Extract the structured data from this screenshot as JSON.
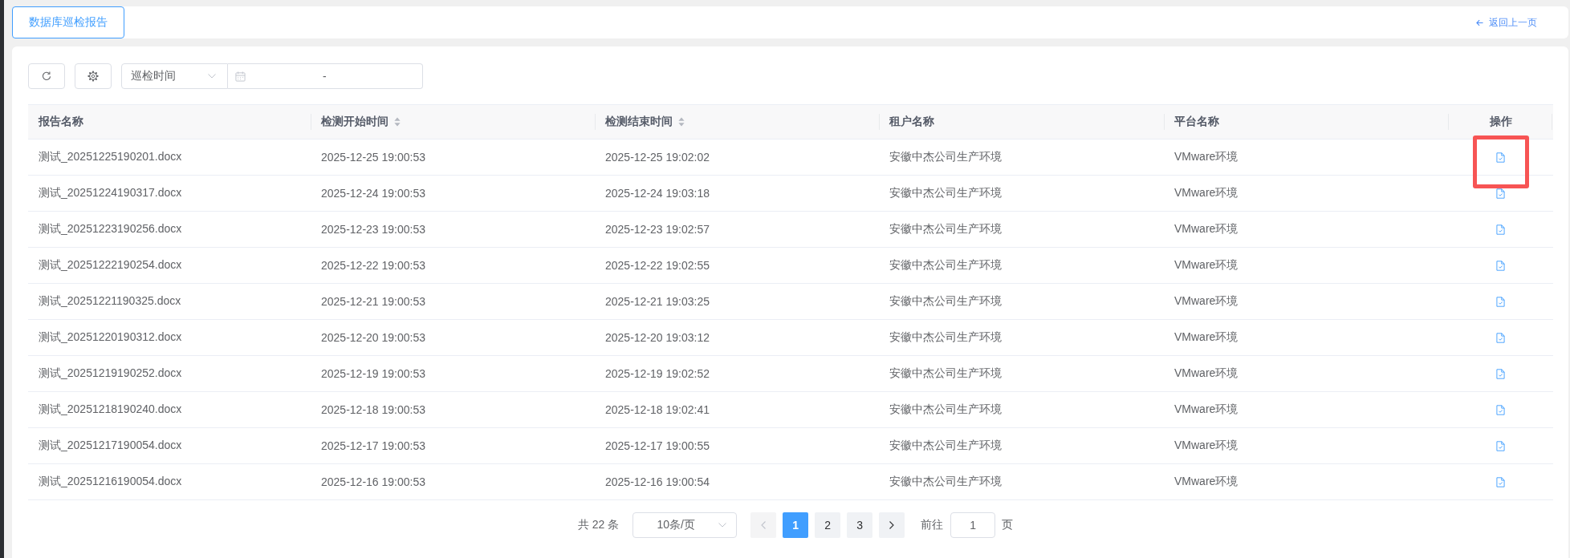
{
  "tabs": [
    {
      "label": "数据库巡检报告",
      "selected": true
    }
  ],
  "back_link": {
    "label": "返回上一页"
  },
  "toolbar": {
    "filter_select": {
      "value": "巡检时间"
    },
    "date_range": {
      "separator": "-"
    }
  },
  "table": {
    "columns": [
      {
        "label": "报告名称",
        "kind": "text",
        "sortable": false
      },
      {
        "label": "检测开始时间",
        "kind": "text",
        "sortable": true
      },
      {
        "label": "检测结束时间",
        "kind": "text",
        "sortable": true
      },
      {
        "label": "租户名称",
        "kind": "text",
        "sortable": false
      },
      {
        "label": "平台名称",
        "kind": "text",
        "sortable": false
      },
      {
        "label": "操作",
        "kind": "action",
        "sortable": false
      }
    ],
    "rows": [
      {
        "cells": [
          "测试_20251225190201.docx",
          "2025-12-25 19:00:53",
          "2025-12-25 19:02:02",
          "安徽中杰公司生产环境",
          "VMware环境"
        ],
        "highlighted": true
      },
      {
        "cells": [
          "测试_20251224190317.docx",
          "2025-12-24 19:00:53",
          "2025-12-24 19:03:18",
          "安徽中杰公司生产环境",
          "VMware环境"
        ],
        "highlighted": false
      },
      {
        "cells": [
          "测试_20251223190256.docx",
          "2025-12-23 19:00:53",
          "2025-12-23 19:02:57",
          "安徽中杰公司生产环境",
          "VMware环境"
        ],
        "highlighted": false
      },
      {
        "cells": [
          "测试_20251222190254.docx",
          "2025-12-22 19:00:53",
          "2025-12-22 19:02:55",
          "安徽中杰公司生产环境",
          "VMware环境"
        ],
        "highlighted": false
      },
      {
        "cells": [
          "测试_20251221190325.docx",
          "2025-12-21 19:00:53",
          "2025-12-21 19:03:25",
          "安徽中杰公司生产环境",
          "VMware环境"
        ],
        "highlighted": false
      },
      {
        "cells": [
          "测试_20251220190312.docx",
          "2025-12-20 19:00:53",
          "2025-12-20 19:03:12",
          "安徽中杰公司生产环境",
          "VMware环境"
        ],
        "highlighted": false
      },
      {
        "cells": [
          "测试_20251219190252.docx",
          "2025-12-19 19:00:53",
          "2025-12-19 19:02:52",
          "安徽中杰公司生产环境",
          "VMware环境"
        ],
        "highlighted": false
      },
      {
        "cells": [
          "测试_20251218190240.docx",
          "2025-12-18 19:00:53",
          "2025-12-18 19:02:41",
          "安徽中杰公司生产环境",
          "VMware环境"
        ],
        "highlighted": false
      },
      {
        "cells": [
          "测试_20251217190054.docx",
          "2025-12-17 19:00:53",
          "2025-12-17 19:00:55",
          "安徽中杰公司生产环境",
          "VMware环境"
        ],
        "highlighted": false
      },
      {
        "cells": [
          "测试_20251216190054.docx",
          "2025-12-16 19:00:53",
          "2025-12-16 19:00:54",
          "安徽中杰公司生产环境",
          "VMware环境"
        ],
        "highlighted": false
      }
    ]
  },
  "pagination": {
    "total": "共 22 条",
    "page_size": "10条/页",
    "prev_disabled": true,
    "next_disabled": false,
    "pages": [
      {
        "label": "1",
        "selected": true
      },
      {
        "label": "2",
        "selected": false
      },
      {
        "label": "3",
        "selected": false
      }
    ],
    "jump_label": "前往",
    "jump_value": "1",
    "jump_suffix": "页"
  }
}
